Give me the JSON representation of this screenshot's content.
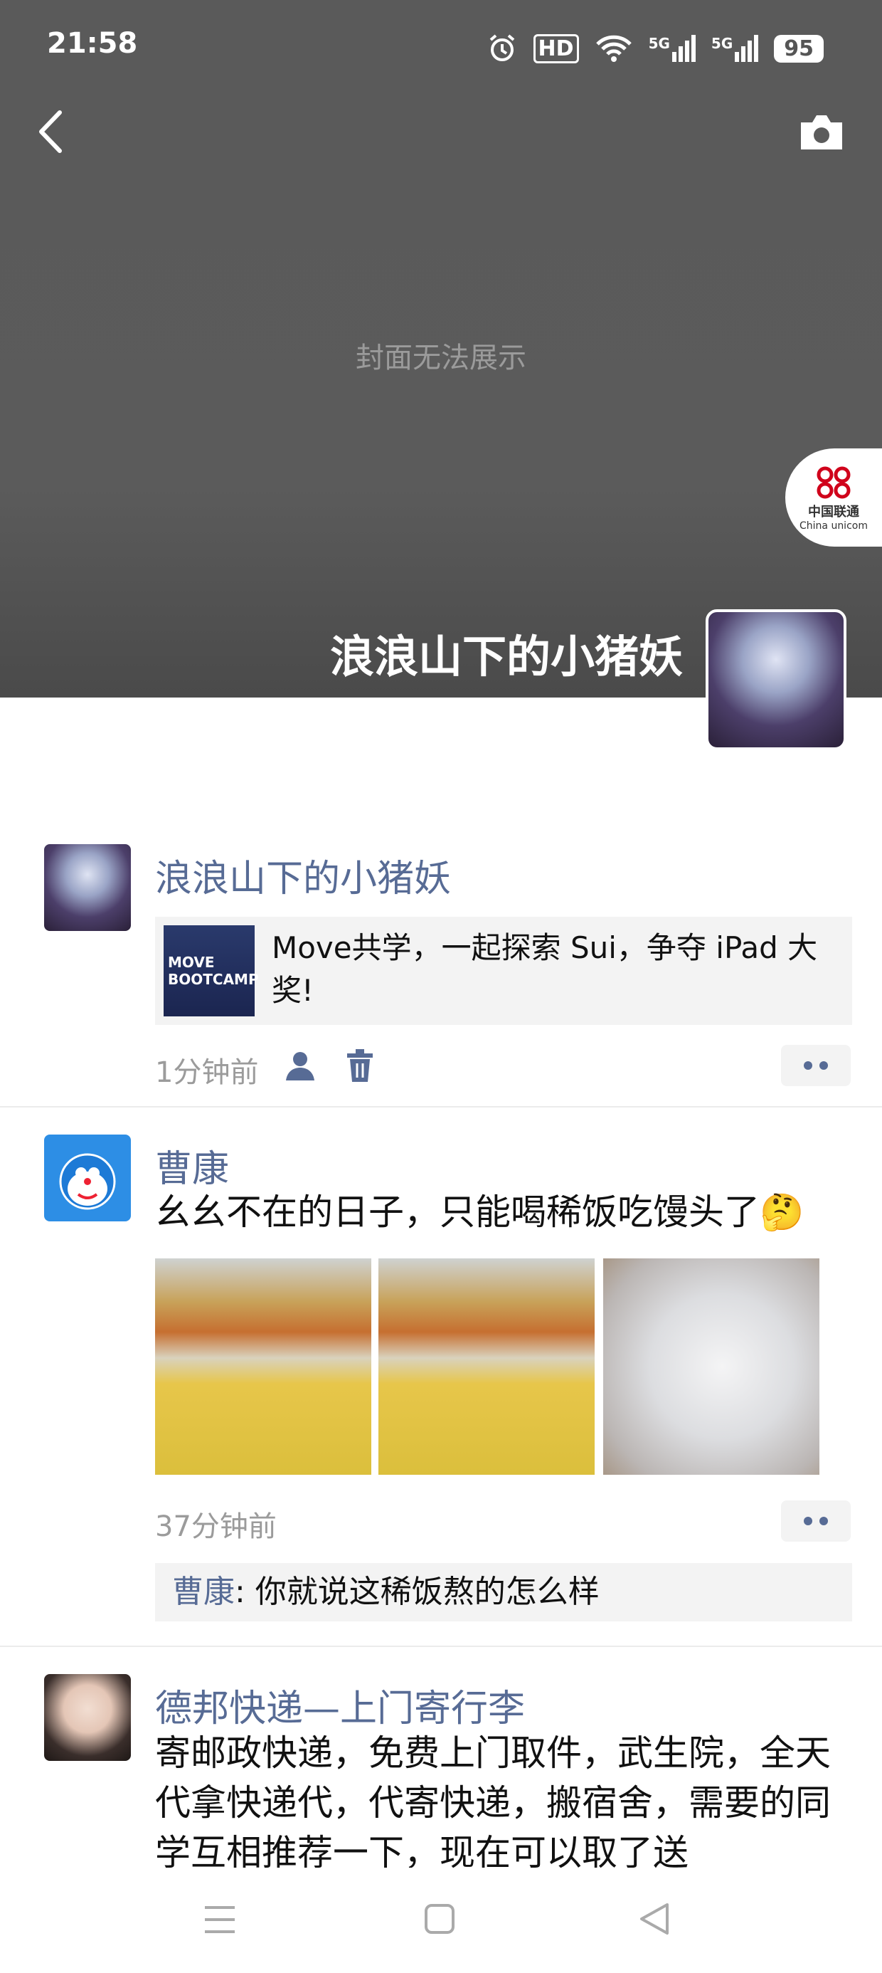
{
  "status_bar": {
    "time": "21:58",
    "hd": "HD",
    "signal1": "5G",
    "signal2": "5G",
    "battery": "95"
  },
  "cover": {
    "placeholder": "封面无法展示",
    "badge_line1": "中国联通",
    "badge_line2": "China unicom"
  },
  "profile": {
    "name": "浪浪山下的小猪妖"
  },
  "posts": [
    {
      "author": "浪浪山下的小猪妖",
      "share_thumb_line1": "MOVE",
      "share_thumb_line2": "BOOTCAMP",
      "share_text": "Move共学，一起探索 Sui，争夺 iPad 大奖!",
      "time": "1分钟前"
    },
    {
      "author": "曹康",
      "text": "幺幺不在的日子，只能喝稀饭吃馒头了🤔",
      "time": "37分钟前",
      "comment_author": "曹康",
      "comment_text": ": 你就说这稀饭熬的怎么样"
    },
    {
      "author": "德邦快递—上门寄行李",
      "text": "寄邮政快递，免费上门取件，武生院，全天代拿快递代，代寄快递，搬宿舍，需要的同学互相推荐一下，现在可以取了送"
    }
  ],
  "colors": {
    "link": "#576b95",
    "cover": "#5b5b5b"
  },
  "icons": [
    "back-icon",
    "camera-icon",
    "alarm-icon",
    "wifi-icon",
    "person-icon",
    "trash-icon",
    "menu-icon",
    "home-icon",
    "back-triangle-icon"
  ]
}
